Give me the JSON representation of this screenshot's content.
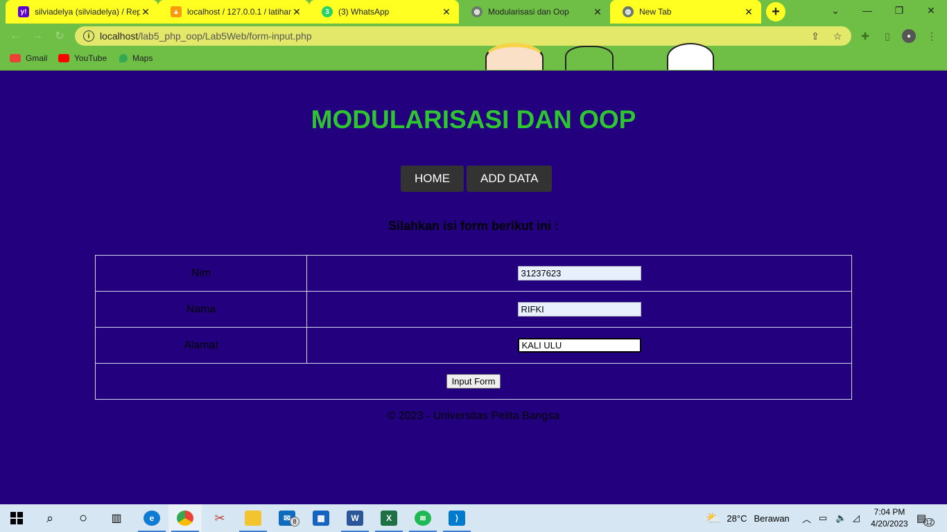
{
  "browser": {
    "tabs": [
      {
        "title": "silviadelya (silviadelya) / Repo",
        "favicon": "yahoo-icon",
        "color": "#6001d2",
        "active": false
      },
      {
        "title": "localhost / 127.0.0.1 / latihan",
        "favicon": "phpmyadmin-icon",
        "color": "#f89c0e",
        "active": false
      },
      {
        "title": "(3) WhatsApp",
        "favicon": "whatsapp-icon",
        "color": "#25d366",
        "active": false
      },
      {
        "title": "Modularisasi dan Oop",
        "favicon": "globe-icon",
        "color": "#5f6368",
        "active": true
      },
      {
        "title": "New Tab",
        "favicon": "globe-icon",
        "color": "#5f6368",
        "active": false
      }
    ],
    "url_host": "localhost",
    "url_path": "/lab5_php_oop/Lab5Web/form-input.php",
    "bookmarks": [
      {
        "label": "Gmail",
        "color": "#ea4335"
      },
      {
        "label": "YouTube",
        "color": "#ff0000"
      },
      {
        "label": "Maps",
        "color": "#34a853"
      }
    ],
    "theme_color": "#6fbe45",
    "tab_highlight": "#ffff22"
  },
  "page": {
    "title": "MODULARISASI DAN OOP",
    "menu": [
      {
        "label": "HOME"
      },
      {
        "label": "ADD DATA"
      }
    ],
    "subtitle": "Silahkan isi form berikut ini :",
    "form": {
      "fields": [
        {
          "label": "Nim",
          "value": "31237623"
        },
        {
          "label": "Nama",
          "value": "RIFKI"
        },
        {
          "label": "Alamat",
          "value": "KALI ULU"
        }
      ],
      "submit_label": "Input Form"
    },
    "footer": "© 2023 - Universitas Pelita Bangsa",
    "background": "#23007e",
    "title_color": "#2ec530"
  },
  "taskbar": {
    "weather_temp": "28°C",
    "weather_text": "Berawan",
    "time": "7:04 PM",
    "date": "4/20/2023",
    "notification_count": "12",
    "mail_badge": "8"
  }
}
